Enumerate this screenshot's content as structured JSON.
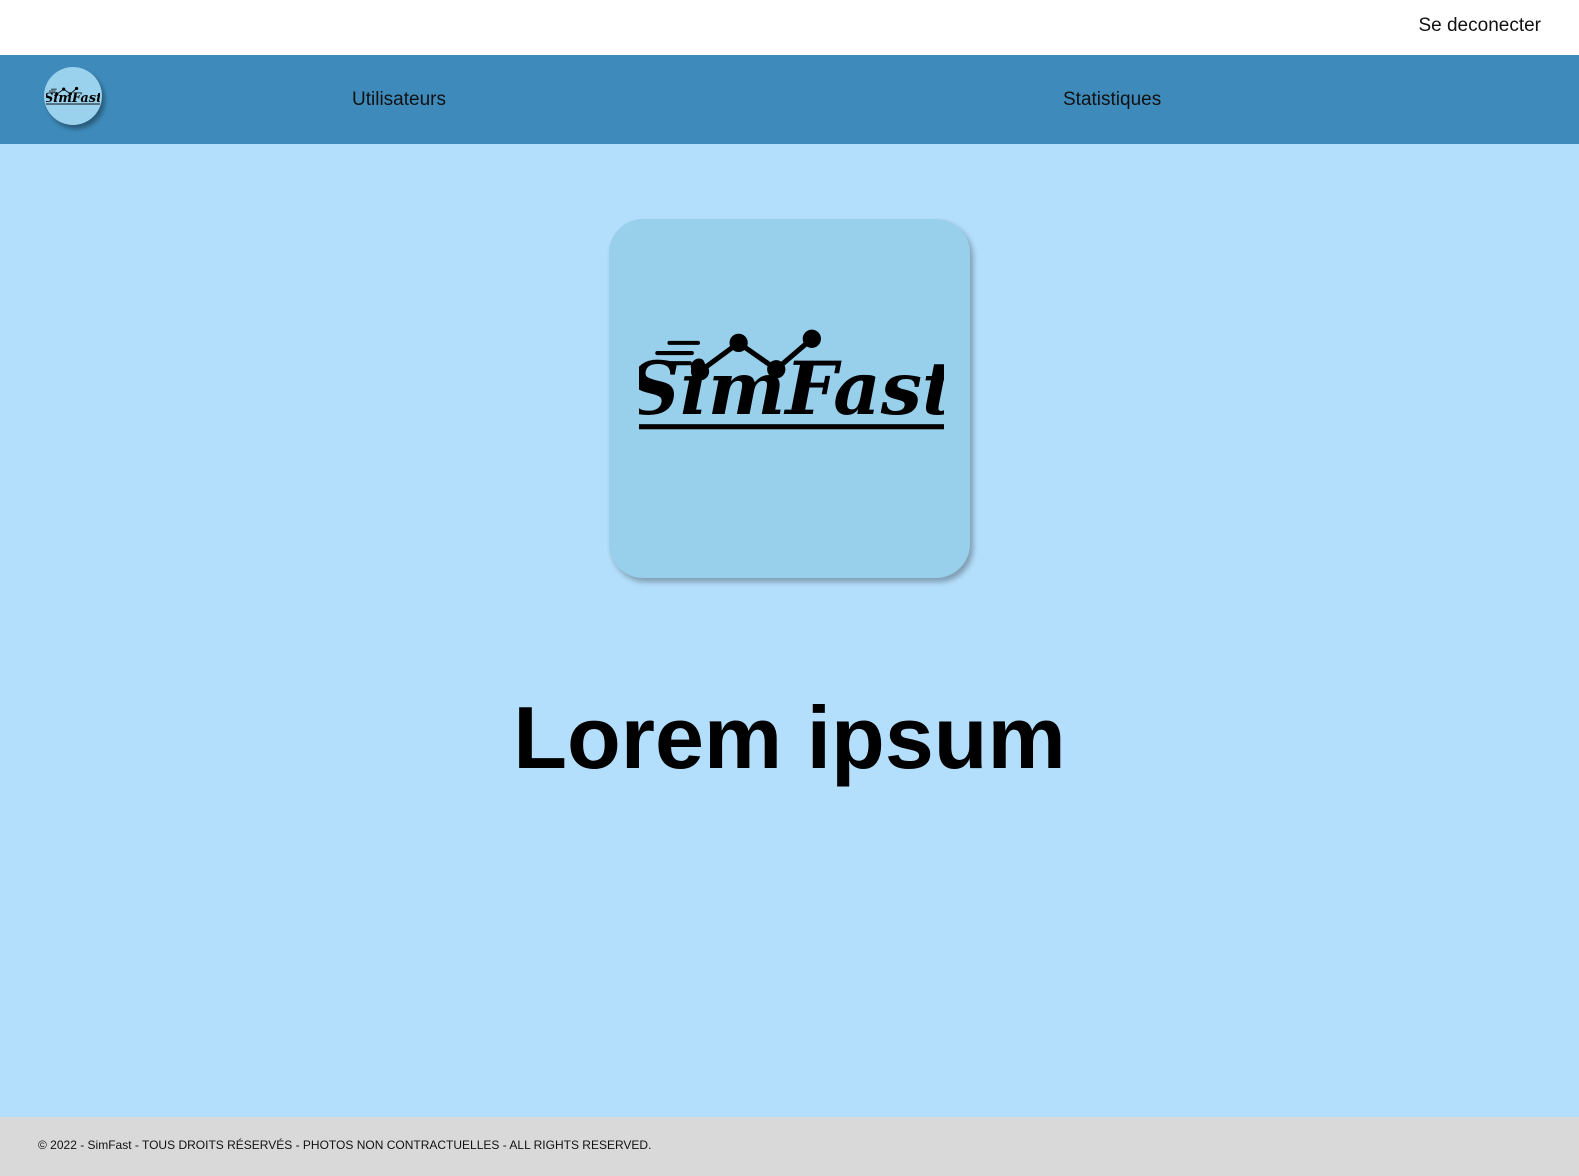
{
  "header": {
    "logout_label": "Se deconecter"
  },
  "nav": {
    "logo_text": "SimFast",
    "items": [
      {
        "label": "Utilisateurs"
      },
      {
        "label": "Statistiques"
      }
    ]
  },
  "main": {
    "logo_text": "SimFast",
    "title": "Lorem ipsum"
  },
  "footer": {
    "text": "© 2022 - SimFast - TOUS DROITS RÉSERVÉS - PHOTOS NON CONTRACTUELLES - ALL RIGHTS RESERVED."
  },
  "colors": {
    "page_background": "#b4dffc",
    "navbar": "#3e8bbb",
    "logo_background": "#98cfeb",
    "footer": "#d9d9d9"
  }
}
